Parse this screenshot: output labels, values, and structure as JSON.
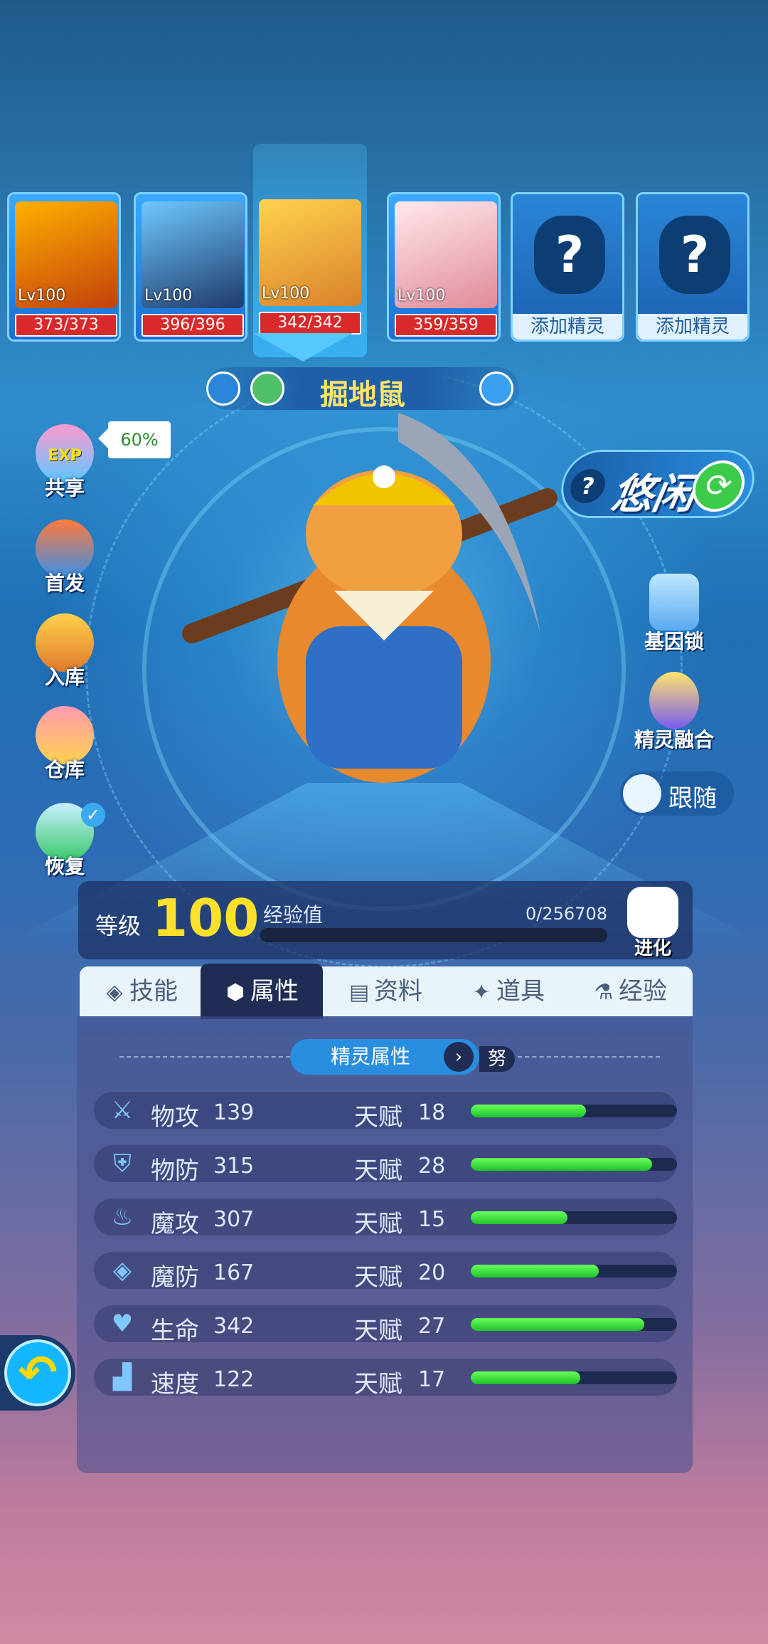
{
  "roster": [
    {
      "level": "Lv100",
      "hp": "373/373",
      "colors": [
        "#ffb000",
        "#c2410c"
      ]
    },
    {
      "level": "Lv100",
      "hp": "396/396",
      "colors": [
        "#6ec8ff",
        "#1f3a6a"
      ]
    },
    {
      "level": "Lv100",
      "hp": "342/342",
      "colors": [
        "#ffd24d",
        "#d9822b"
      ]
    },
    {
      "level": "Lv100",
      "hp": "359/359",
      "colors": [
        "#ffe9ec",
        "#e08a9a"
      ]
    }
  ],
  "add_slots": [
    {
      "label": "添加精灵",
      "mark": "?"
    },
    {
      "label": "添加精灵",
      "mark": "?"
    }
  ],
  "pet_name": "掘地鼠",
  "left_menu": {
    "share": {
      "label": "共享",
      "badge": "EXP",
      "tooltip": "60%"
    },
    "first": {
      "label": "首发"
    },
    "store": {
      "label": "入库"
    },
    "warehouse": {
      "label": "仓库"
    },
    "restore": {
      "label": "恢复"
    }
  },
  "idle": {
    "label": "悠闲",
    "mark": "?"
  },
  "right_menu": {
    "gene_lock": "基因锁",
    "fusion": "精灵融合",
    "follow": "跟随"
  },
  "level_panel": {
    "label": "等级",
    "level": "100",
    "exp_label": "经验值",
    "exp_value": "0/256708",
    "exp_fraction": 0,
    "evolve": "进化"
  },
  "tabs": [
    {
      "label": "技能",
      "icon": "◈"
    },
    {
      "label": "属性",
      "icon": "⬢"
    },
    {
      "label": "资料",
      "icon": "▤"
    },
    {
      "label": "道具",
      "icon": "✦"
    },
    {
      "label": "经验",
      "icon": "⚗"
    }
  ],
  "attributes_header": {
    "title": "精灵属性",
    "extra": "努"
  },
  "attributes": [
    {
      "name": "物攻",
      "value": "139",
      "talent_label": "天赋",
      "talent": "18",
      "fill": 0.56,
      "icon": "sword-icon"
    },
    {
      "name": "物防",
      "value": "315",
      "talent_label": "天赋",
      "talent": "28",
      "fill": 0.88,
      "icon": "shield-icon"
    },
    {
      "name": "魔攻",
      "value": "307",
      "talent_label": "天赋",
      "talent": "15",
      "fill": 0.47,
      "icon": "flame-icon"
    },
    {
      "name": "魔防",
      "value": "167",
      "talent_label": "天赋",
      "talent": "20",
      "fill": 0.62,
      "icon": "magic-shield-icon"
    },
    {
      "name": "生命",
      "value": "342",
      "talent_label": "天赋",
      "talent": "27",
      "fill": 0.84,
      "icon": "heart-plus-icon"
    },
    {
      "name": "速度",
      "value": "122",
      "talent_label": "天赋",
      "talent": "17",
      "fill": 0.53,
      "icon": "boot-icon"
    }
  ],
  "back_icon": "back-arrow-icon"
}
